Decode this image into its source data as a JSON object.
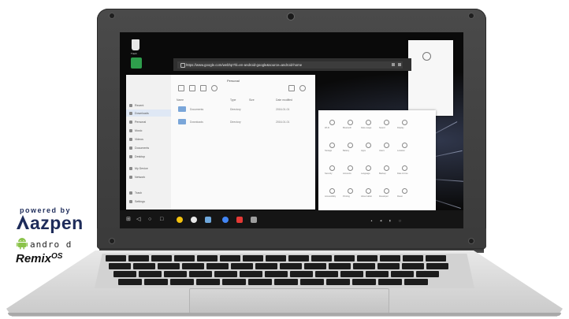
{
  "brand": {
    "powered_by": "powered by",
    "name": "azpen",
    "android_logo_text": "andro d",
    "remix_text": "Remix",
    "remix_suffix": "OS",
    "color": "#1e2c5a"
  },
  "screen": {
    "desktop": {
      "icons": [
        {
          "name": "trash-icon",
          "label": "Trash"
        },
        {
          "name": "app-icon",
          "label": ""
        }
      ]
    },
    "browser": {
      "url": "https://www.google.com/webhp?hl=en-android-google&source=android-home"
    },
    "file_manager": {
      "title": "Personal",
      "sidebar": [
        {
          "label": "Recent"
        },
        {
          "label": "Downloads"
        },
        {
          "label": "Personal"
        },
        {
          "label": "Music"
        },
        {
          "label": "Videos"
        },
        {
          "label": "Documents"
        },
        {
          "label": "Desktop"
        },
        {
          "label": "My Device"
        },
        {
          "label": "Network"
        },
        {
          "label": "Trash"
        },
        {
          "label": "Settings"
        }
      ],
      "columns": [
        "Name",
        "Type",
        "Size",
        "Date modified"
      ],
      "rows": [
        {
          "name": "Documents",
          "type": "Directory",
          "size": "",
          "date": "2016-01-01"
        },
        {
          "name": "Downloads",
          "type": "Directory",
          "size": "",
          "date": "2016-01-01"
        }
      ]
    },
    "settings_icons": [
      "Wi-Fi",
      "Bluetooth",
      "Data usage",
      "Sound",
      "Display",
      "Storage",
      "Battery",
      "Apps",
      "Users",
      "Location",
      "Security",
      "Accounts",
      "Language",
      "Backup",
      "Date & time",
      "Accessibility",
      "Printing",
      "About tablet",
      "Developer",
      "Reset"
    ]
  },
  "colors": {
    "bezel": "#3b3b3b",
    "taskbar": "#151515",
    "folder": "#7aa6d9",
    "chrome_icon": "#4285f4",
    "accent_yellow": "#f4c20d",
    "accent_red": "#e53935"
  }
}
